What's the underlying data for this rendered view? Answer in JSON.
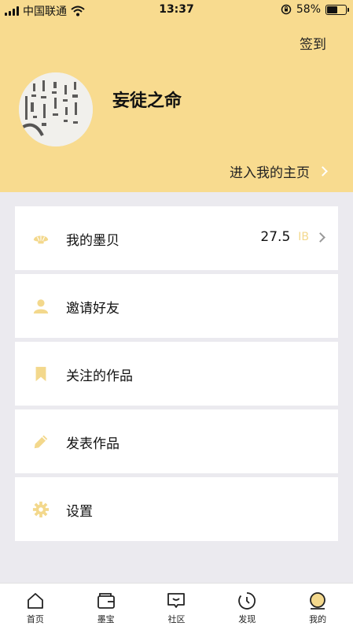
{
  "status": {
    "carrier": "中国联通",
    "time": "13:37",
    "battery": "58%",
    "battery_level": 0.58
  },
  "header": {
    "checkin_label": "签到",
    "username": "妄徒之命",
    "homepage_link": "进入我的主页"
  },
  "menu": [
    {
      "label": "我的墨贝",
      "value": "27.5",
      "unit": "IB",
      "icon": "shell-icon"
    },
    {
      "label": "邀请好友",
      "icon": "user-icon"
    },
    {
      "label": "关注的作品",
      "icon": "bookmark-icon"
    },
    {
      "label": "发表作品",
      "icon": "pencil-icon"
    },
    {
      "label": "设置",
      "icon": "gear-icon"
    }
  ],
  "tabs": [
    {
      "label": "首页",
      "icon": "home-icon"
    },
    {
      "label": "墨宝",
      "icon": "wallet-icon"
    },
    {
      "label": "社区",
      "icon": "chat-icon"
    },
    {
      "label": "发现",
      "icon": "discover-icon"
    },
    {
      "label": "我的",
      "icon": "profile-icon",
      "active": true
    }
  ],
  "colors": {
    "header_bg": "#f8db8f",
    "accent": "#f3d88c",
    "page_bg": "#ebeaef"
  }
}
